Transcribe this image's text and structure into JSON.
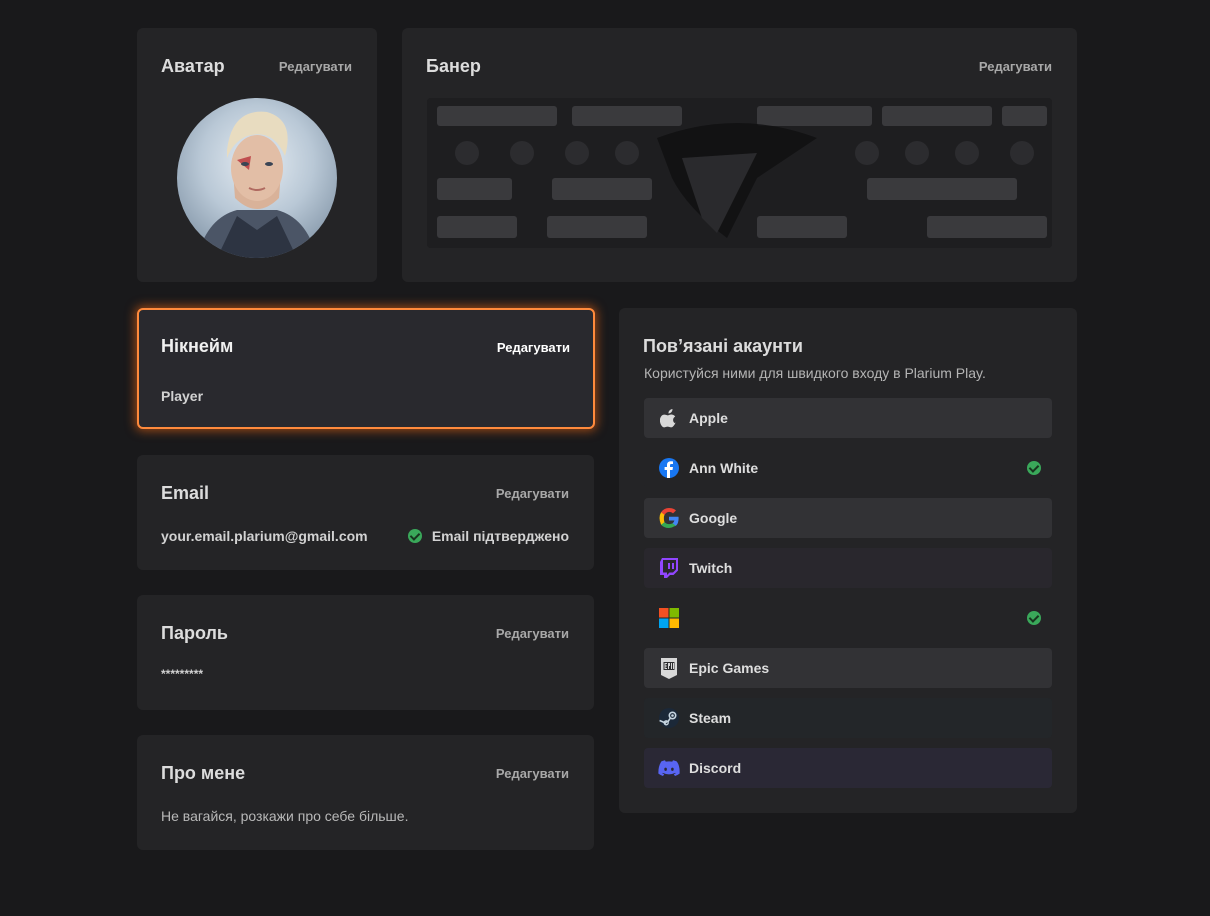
{
  "avatar": {
    "title": "Аватар",
    "edit_label": "Редагувати"
  },
  "banner": {
    "title": "Банер",
    "edit_label": "Редагувати"
  },
  "nickname": {
    "title": "Нікнейм",
    "edit_label": "Редагувати",
    "value": "Player"
  },
  "email": {
    "title": "Email",
    "edit_label": "Редагувати",
    "value": "your.email.plarium@gmail.com",
    "status": "Email підтверджено"
  },
  "password": {
    "title": "Пароль",
    "edit_label": "Редагувати",
    "value": "*********"
  },
  "about": {
    "title": "Про мене",
    "edit_label": "Редагувати",
    "value": "Не вагайся, розкажи про себе більше."
  },
  "linked": {
    "title": "Пов’язані акаунти",
    "subtitle": "Користуйся ними для швидкого входу в Plarium Play.",
    "accounts": [
      {
        "label": "Apple",
        "icon": "apple-icon",
        "connected": false,
        "bg": "#323235"
      },
      {
        "label": "Ann White",
        "icon": "facebook-icon",
        "connected": true,
        "bg": "#242426"
      },
      {
        "label": "Google",
        "icon": "google-icon",
        "connected": false,
        "bg": "#323235"
      },
      {
        "label": "Twitch",
        "icon": "twitch-icon",
        "connected": false,
        "bg": "#29272d"
      },
      {
        "label": "",
        "icon": "microsoft-icon",
        "connected": true,
        "bg": "#242426"
      },
      {
        "label": "Epic Games",
        "icon": "epic-games-icon",
        "connected": false,
        "bg": "#323235"
      },
      {
        "label": "Steam",
        "icon": "steam-icon",
        "connected": false,
        "bg": "#232629"
      },
      {
        "label": "Discord",
        "icon": "discord-icon",
        "connected": false,
        "bg": "#2a2835"
      }
    ]
  },
  "colors": {
    "accent": "#ff8a3c",
    "verified": "#3aa85a",
    "background": "#19191b",
    "card": "#242426"
  }
}
